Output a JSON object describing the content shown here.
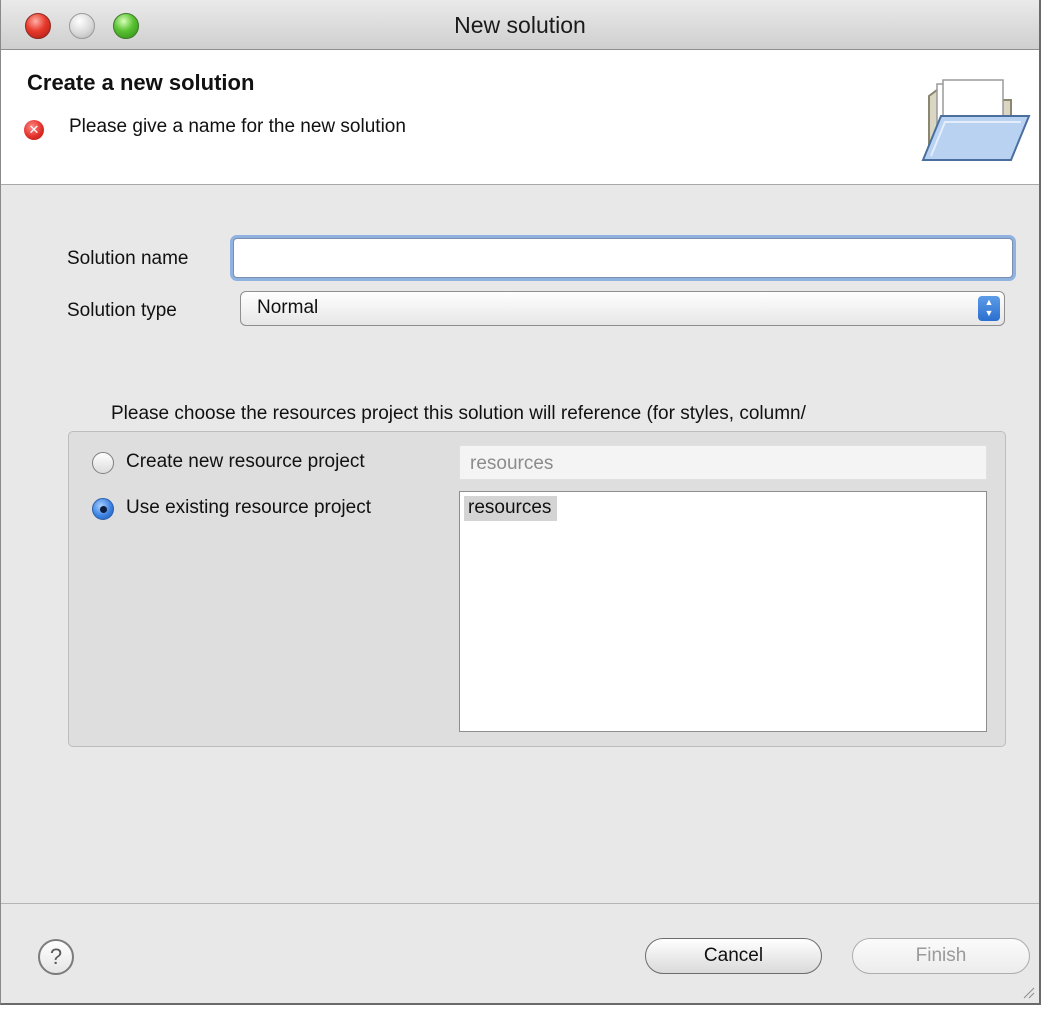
{
  "window": {
    "title": "New solution"
  },
  "header": {
    "title": "Create a new solution",
    "message": "Please give a name for the new solution",
    "message_icon": "error-icon",
    "banner_icon": "open-folder-icon"
  },
  "form": {
    "solution_name_label": "Solution name",
    "solution_name_value": "",
    "solution_type_label": "Solution type",
    "solution_type_value": "Normal"
  },
  "resources": {
    "description": "Please choose the resources project this solution will reference (for styles, column/",
    "create_new_label": "Create new resource project",
    "create_new_placeholder": "resources",
    "use_existing_label": "Use existing resource project",
    "existing_projects": [
      "resources"
    ],
    "selected": "use_existing"
  },
  "footer": {
    "cancel_label": "Cancel",
    "finish_label": "Finish"
  },
  "colors": {
    "focus_ring": "#8fb2e0",
    "error": "#e4302b",
    "radio_selected": "#3d84e3"
  }
}
